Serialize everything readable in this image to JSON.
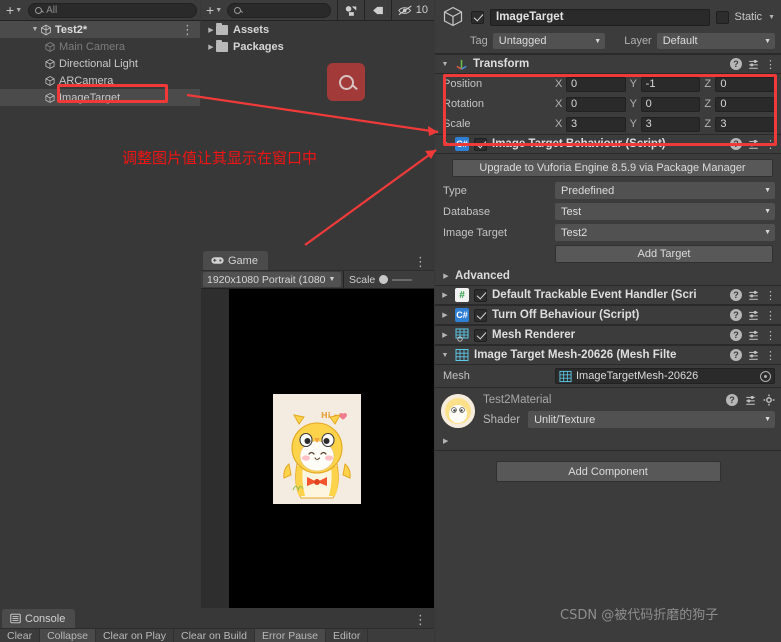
{
  "hierarchy": {
    "search_placeholder": "All",
    "add_label": "+",
    "kebab": "⋮",
    "items": [
      {
        "label": "Test2*",
        "type": "scene",
        "indent": 0,
        "selected": false,
        "dim": false
      },
      {
        "label": "Main Camera",
        "type": "gameobject",
        "indent": 1,
        "selected": false,
        "dim": true
      },
      {
        "label": "Directional Light",
        "type": "gameobject",
        "indent": 1,
        "selected": false,
        "dim": false
      },
      {
        "label": "ARCamera",
        "type": "gameobject",
        "indent": 1,
        "selected": false,
        "dim": false
      },
      {
        "label": "ImageTarget",
        "type": "gameobject",
        "indent": 1,
        "selected": true,
        "dim": false
      }
    ]
  },
  "project": {
    "add_label": "+",
    "search_value": "",
    "hidden_count": "10",
    "icons": [
      "shapes-icon",
      "tag-icon",
      "eye-slash-icon"
    ],
    "items": [
      {
        "label": "Assets"
      },
      {
        "label": "Packages"
      }
    ],
    "search_badge_icon": "search-icon"
  },
  "game_view": {
    "tab_label": "Game",
    "tab_icon": "gamepad-icon",
    "kebab": "⋮",
    "resolution": "1920x1080 Portrait (1080",
    "scale_label": "Scale",
    "canvas_bg": "#000000",
    "character_alt": "yellow chick hoodie character",
    "character_caption": "Hi ~"
  },
  "console": {
    "tab_label": "Console",
    "tab_icon": "console-icon",
    "kebab": "⋮",
    "buttons": [
      "Clear",
      "Collapse",
      "Clear on Play",
      "Clear on Build",
      "Error Pause",
      "Editor"
    ]
  },
  "inspector": {
    "gameobject": {
      "enabled": true,
      "name": "ImageTarget",
      "static_label": "Static",
      "static_checked": false,
      "tag_label": "Tag",
      "tag_value": "Untagged",
      "layer_label": "Layer",
      "layer_value": "Default"
    },
    "transform": {
      "title": "Transform",
      "rows": [
        {
          "label": "Position",
          "x": "0",
          "y": "-1",
          "z": "0"
        },
        {
          "label": "Rotation",
          "x": "0",
          "y": "0",
          "z": "0"
        },
        {
          "label": "Scale",
          "x": "3",
          "y": "3",
          "z": "3"
        }
      ],
      "axes": [
        "X",
        "Y",
        "Z"
      ]
    },
    "image_target_behaviour": {
      "title": "Image Target Behaviour (Script)",
      "enabled": true,
      "upgrade_button": "Upgrade to Vuforia Engine 8.5.9 via Package Manager",
      "fields": [
        {
          "label": "Type",
          "value": "Predefined"
        },
        {
          "label": "Database",
          "value": "Test"
        },
        {
          "label": "Image Target",
          "value": "Test2"
        }
      ],
      "add_target_button": "Add Target",
      "advanced_label": "Advanced"
    },
    "components": [
      {
        "title": "Default Trackable Event Handler (Scri",
        "enabled": true,
        "icon": "csharp-script-icon"
      },
      {
        "title": "Turn Off Behaviour (Script)",
        "enabled": true,
        "icon": "csharp-script-icon"
      },
      {
        "title": "Mesh Renderer",
        "enabled": true,
        "icon": "mesh-renderer-icon"
      }
    ],
    "mesh_filter": {
      "title": "Image Target Mesh-20626 (Mesh Filte",
      "mesh_label": "Mesh",
      "mesh_value": "ImageTargetMesh-20626"
    },
    "material": {
      "name": "Test2Material",
      "shader_label": "Shader",
      "shader_value": "Unlit/Texture"
    },
    "add_component_button": "Add Component"
  },
  "annotations": {
    "note_text": "调整图片值让其显示在窗口中",
    "note_color": "#f01414",
    "highlight_color": "#f03a3a",
    "watermark": "CSDN @被代码折磨的狗子"
  }
}
